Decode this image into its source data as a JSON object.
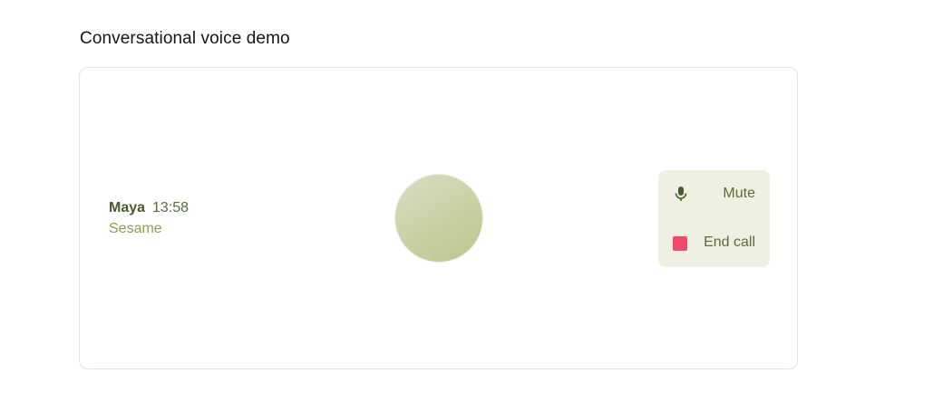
{
  "section": {
    "title": "Conversational voice demo"
  },
  "caller": {
    "name": "Maya",
    "timer": "13:58",
    "org": "Sesame"
  },
  "controls": {
    "mute_label": "Mute",
    "mute_icon": "microphone-icon",
    "end_label": "End call",
    "end_icon": "stop-square-icon",
    "end_color": "#f24a6a"
  },
  "colors": {
    "accent_text": "#5a6a3c",
    "org_text": "#8ca052",
    "panel_bg": "#eff0e2",
    "orb": "#c6cf9f"
  }
}
